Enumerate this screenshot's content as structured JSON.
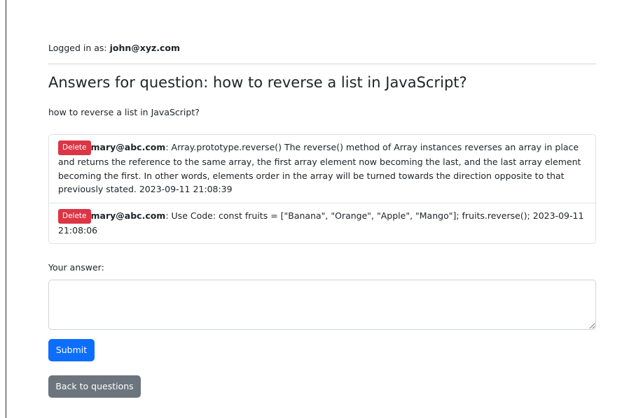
{
  "header": {
    "logged_in_prefix": "Logged in as: ",
    "user_email": "john@xyz.com"
  },
  "page": {
    "title": "Answers for question: how to reverse a list in JavaScript?",
    "question_text": "how to reverse a list in JavaScript?"
  },
  "answers": [
    {
      "delete_label": "Delete",
      "author": "mary@abc.com",
      "text": ": Array.prototype.reverse() The reverse() method of Array instances reverses an array in place and returns the reference to the same array, the first array element now becoming the last, and the last array element becoming the first. In other words, elements order in the array will be turned towards the direction opposite to that previously stated. 2023-09-11 21:08:39"
    },
    {
      "delete_label": "Delete",
      "author": "mary@abc.com",
      "text": ": Use Code: const fruits = [\"Banana\", \"Orange\", \"Apple\", \"Mango\"]; fruits.reverse(); 2023-09-11 21:08:06"
    }
  ],
  "form": {
    "label": "Your answer:",
    "textarea_value": "",
    "submit_label": "Submit"
  },
  "nav": {
    "back_label": "Back to questions"
  },
  "colors": {
    "delete": "#dc3545",
    "submit": "#0d6efd",
    "back": "#6c757d"
  }
}
